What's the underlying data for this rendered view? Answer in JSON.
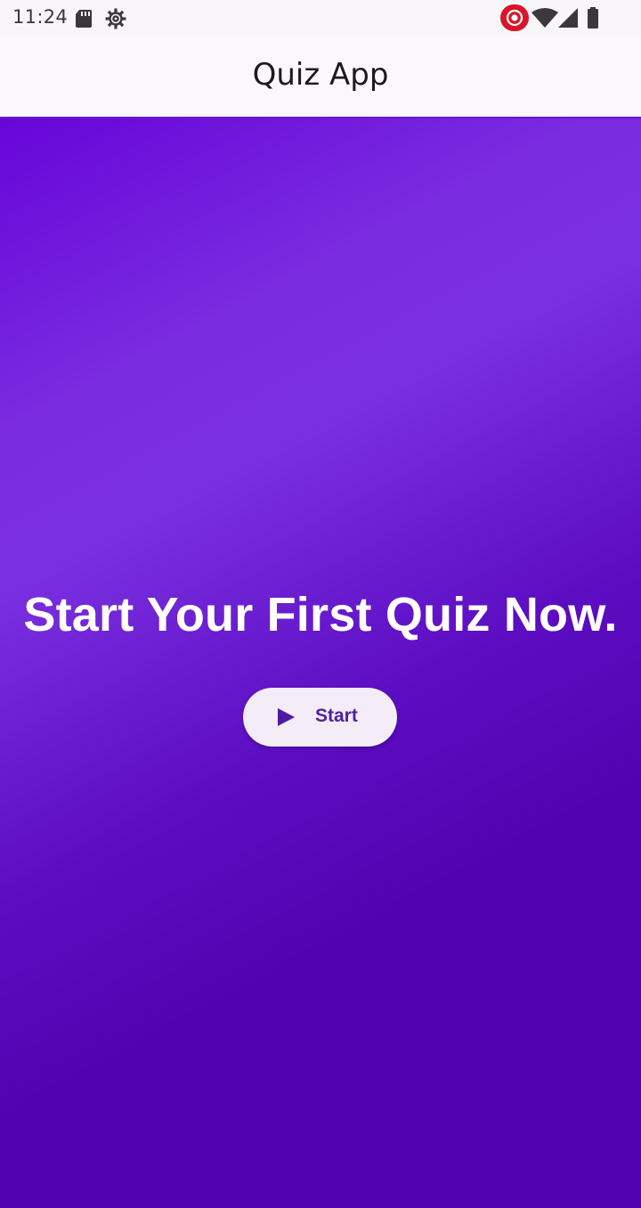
{
  "status_bar": {
    "time": "11:24",
    "icons": [
      "sd-card-icon",
      "settings-gear-icon",
      "screen-record-icon",
      "wifi-icon",
      "cellular-signal-icon",
      "battery-icon"
    ]
  },
  "app_bar": {
    "title": "Quiz App"
  },
  "main": {
    "headline": "Start Your First Quiz Now.",
    "start_button": {
      "label": "Start",
      "icon": "play-icon"
    }
  },
  "colors": {
    "gradient_start": "#6605d8",
    "gradient_mid": "#7a2ce0",
    "gradient_end": "#5003ae",
    "button_bg": "#f4ecf6",
    "button_text": "#5020a0",
    "record_indicator": "#d9152c"
  }
}
